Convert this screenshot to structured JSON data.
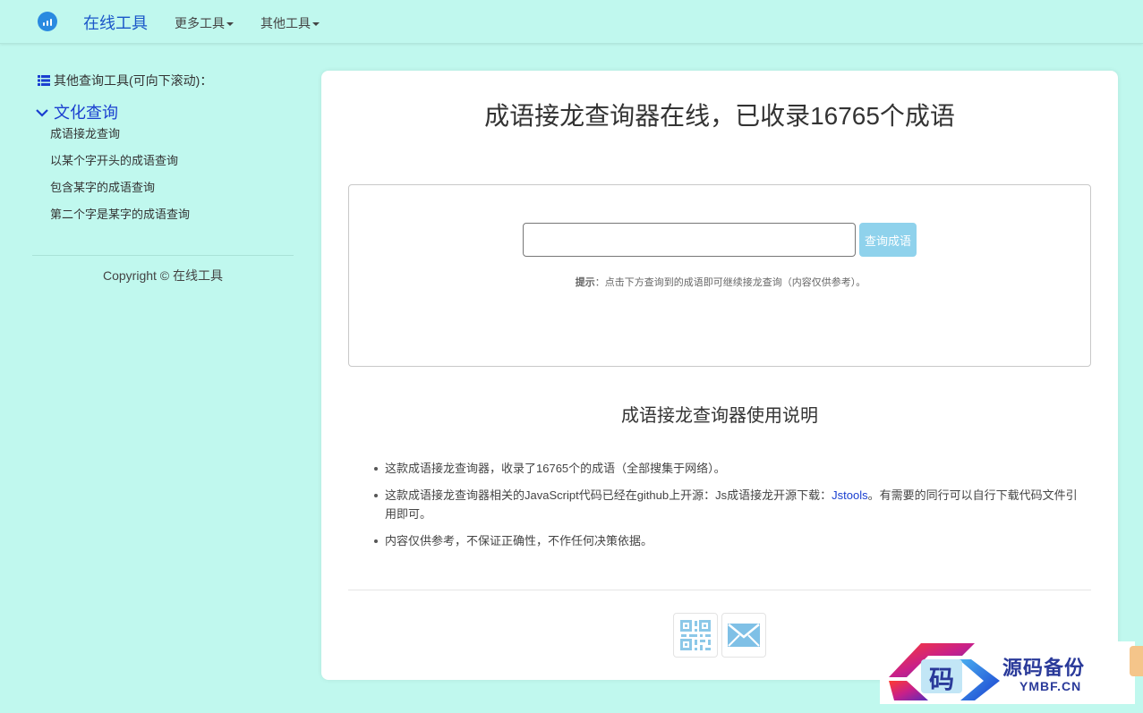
{
  "navbar": {
    "brand": "在线工具",
    "menus": [
      {
        "label": "更多工具"
      },
      {
        "label": "其他工具"
      }
    ]
  },
  "sidebar": {
    "header": "其他查询工具(可向下滚动)：",
    "category": "文化查询",
    "links": [
      "成语接龙查询",
      "以某个字开头的成语查询",
      "包含某字的成语查询",
      "第二个字是某字的成语查询"
    ],
    "copyright": "Copyright © 在线工具"
  },
  "main": {
    "title": "成语接龙查询器在线，已收录16765个成语",
    "search": {
      "value": "",
      "placeholder": "",
      "button_label": "查询成语"
    },
    "hint_label": "提示",
    "hint_text": "：点击下方查询到的成语即可继续接龙查询（内容仅供参考）。",
    "subtitle": "成语接龙查询器使用说明",
    "notes": {
      "n1": "这款成语接龙查询器，收录了16765个的成语（全部搜集于网络）。",
      "n2_pre": "这款成语接龙查询器相关的JavaScript代码已经在github上开源：Js成语接龙开源下载：",
      "n2_link": "Jstools",
      "n2_post": "。有需要的同行可以自行下载代码文件引用即可。",
      "n3": "内容仅供参考，不保证正确性，不作任何决策依据。"
    },
    "share": [
      {
        "icon": "qrcode-icon"
      },
      {
        "icon": "mail-icon"
      }
    ]
  },
  "watermark": {
    "glyph": "码",
    "cn": "源码备份",
    "en": "YMBF.CN"
  },
  "colors": {
    "background": "#c0f8ee",
    "brand": "#1a56c8",
    "category": "#1a3fd0",
    "button": "#8fd2ec"
  }
}
